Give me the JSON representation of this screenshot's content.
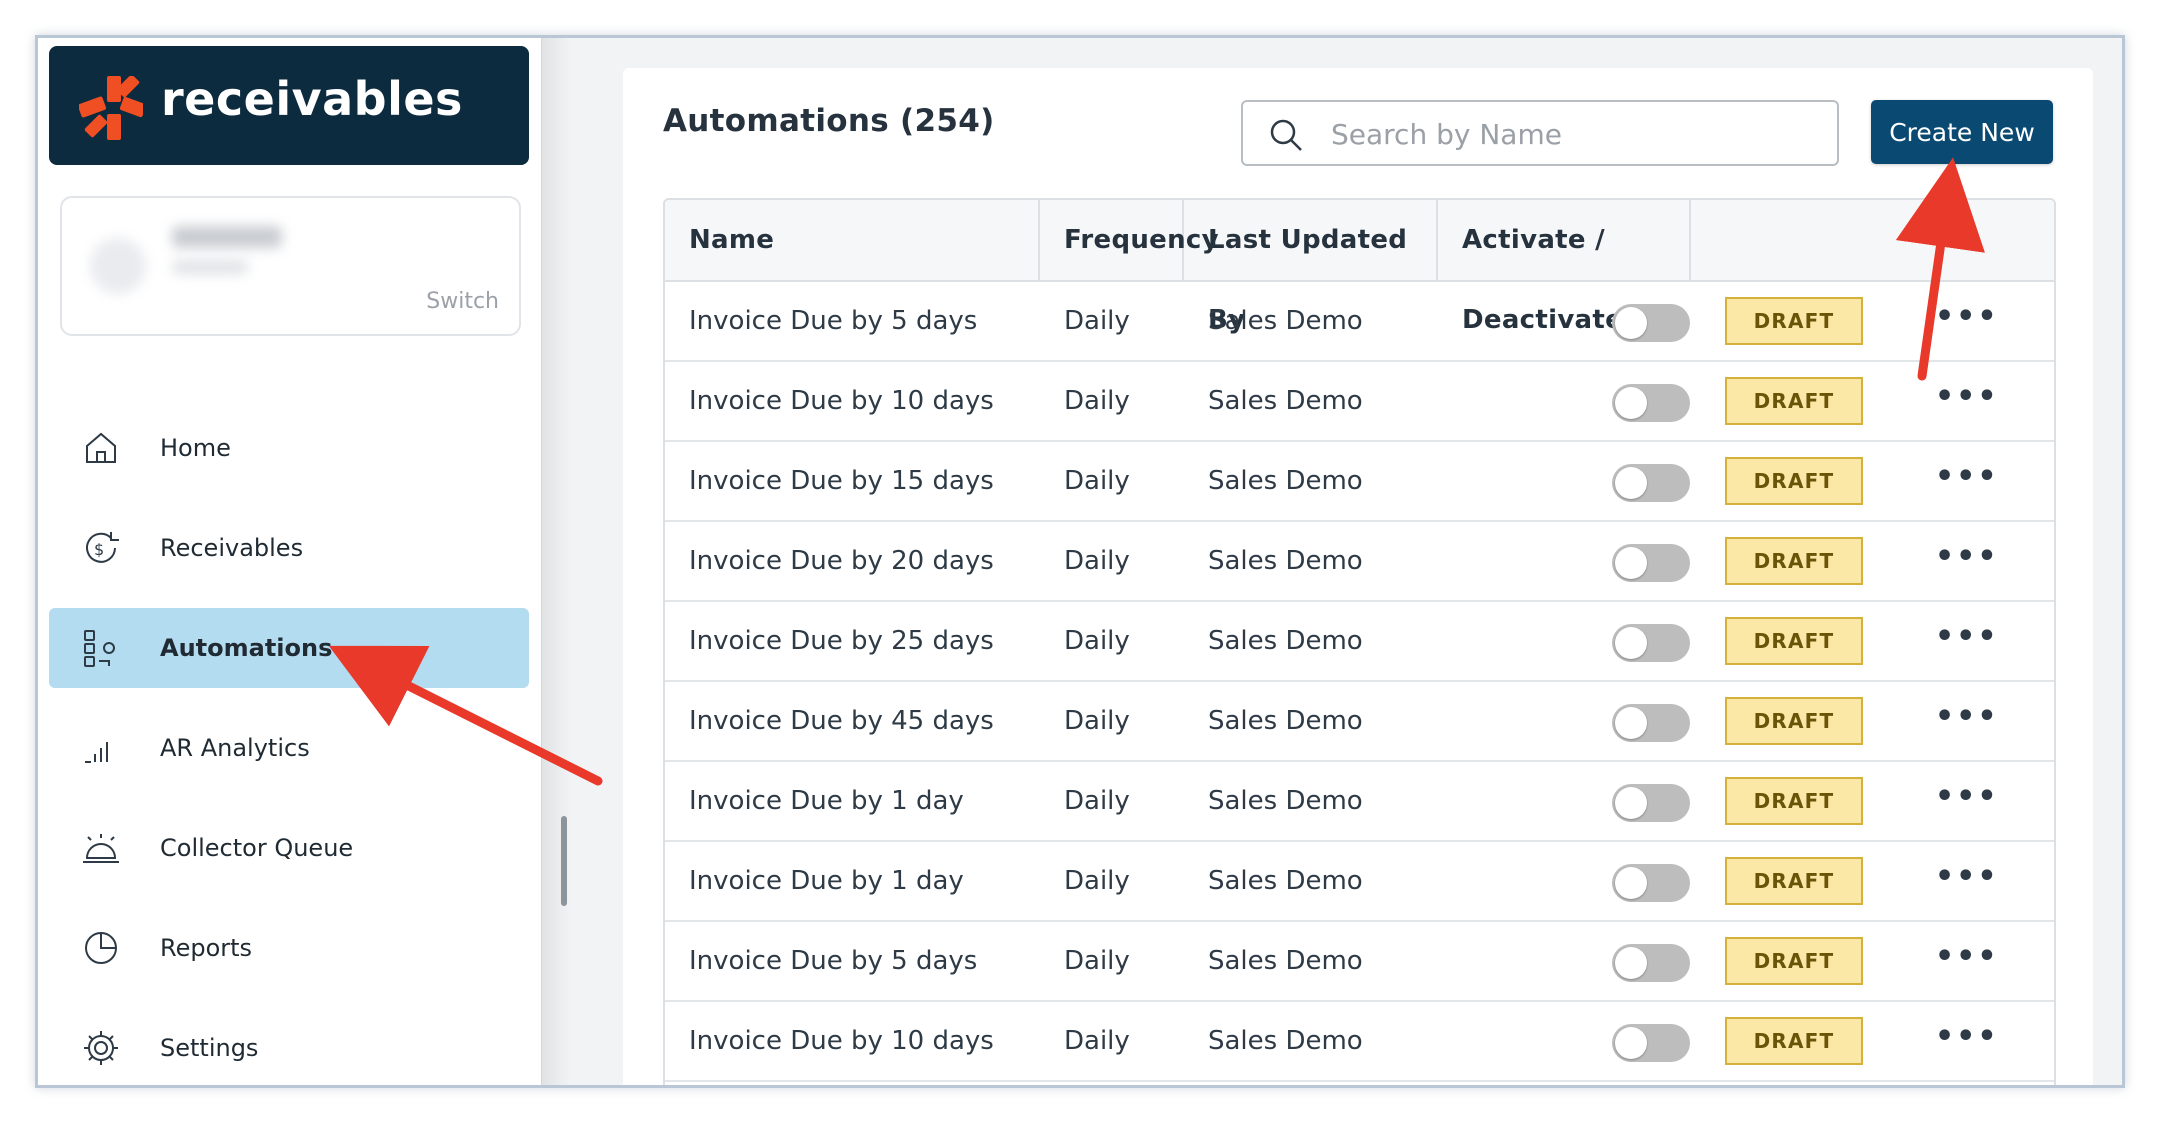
{
  "brand": {
    "logo_icon": "asterisk-logo-icon",
    "name": "receivables",
    "accent": "#f04e23",
    "bg": "#0d2b3e"
  },
  "account": {
    "switch_label": "Switch"
  },
  "nav": {
    "items": [
      {
        "label": "Home",
        "icon": "home-icon"
      },
      {
        "label": "Receivables",
        "icon": "dollar-cycle-icon"
      },
      {
        "label": "Automations",
        "icon": "automation-flow-icon",
        "active": true
      },
      {
        "label": "AR Analytics",
        "icon": "bar-chart-icon"
      },
      {
        "label": "Collector Queue",
        "icon": "service-bell-icon"
      },
      {
        "label": "Reports",
        "icon": "pie-chart-icon"
      },
      {
        "label": "Settings",
        "icon": "gear-icon"
      }
    ]
  },
  "main": {
    "title": "Automations (254)",
    "search_placeholder": "Search by Name",
    "create_label": "Create New"
  },
  "table": {
    "columns": [
      "Name",
      "Frequency",
      "Last Updated By",
      "Activate / Deactivate"
    ],
    "rows": [
      {
        "name": "Invoice Due by 5 days",
        "frequency": "Daily",
        "updated_by": "Sales Demo",
        "active": false,
        "status": "DRAFT"
      },
      {
        "name": "Invoice Due by 10 days",
        "frequency": "Daily",
        "updated_by": "Sales Demo",
        "active": false,
        "status": "DRAFT"
      },
      {
        "name": "Invoice Due by 15 days",
        "frequency": "Daily",
        "updated_by": "Sales Demo",
        "active": false,
        "status": "DRAFT"
      },
      {
        "name": "Invoice Due by 20 days",
        "frequency": "Daily",
        "updated_by": "Sales Demo",
        "active": false,
        "status": "DRAFT"
      },
      {
        "name": "Invoice Due by 25 days",
        "frequency": "Daily",
        "updated_by": "Sales Demo",
        "active": false,
        "status": "DRAFT"
      },
      {
        "name": "Invoice Due by 45 days",
        "frequency": "Daily",
        "updated_by": "Sales Demo",
        "active": false,
        "status": "DRAFT"
      },
      {
        "name": "Invoice Due by 1 day",
        "frequency": "Daily",
        "updated_by": "Sales Demo",
        "active": false,
        "status": "DRAFT"
      },
      {
        "name": "Invoice Due by 1 day",
        "frequency": "Daily",
        "updated_by": "Sales Demo",
        "active": false,
        "status": "DRAFT"
      },
      {
        "name": "Invoice Due by 5 days",
        "frequency": "Daily",
        "updated_by": "Sales Demo",
        "active": false,
        "status": "DRAFT"
      },
      {
        "name": "Invoice Due by 10 days",
        "frequency": "Daily",
        "updated_by": "Sales Demo",
        "active": false,
        "status": "DRAFT"
      }
    ],
    "more_icon": "more-horizontal-icon"
  },
  "colors": {
    "primary": "#0a4a72",
    "active_nav": "#b4dcf1",
    "draft_bg": "#fbe8a6",
    "annotation_arrow": "#e8392b"
  }
}
